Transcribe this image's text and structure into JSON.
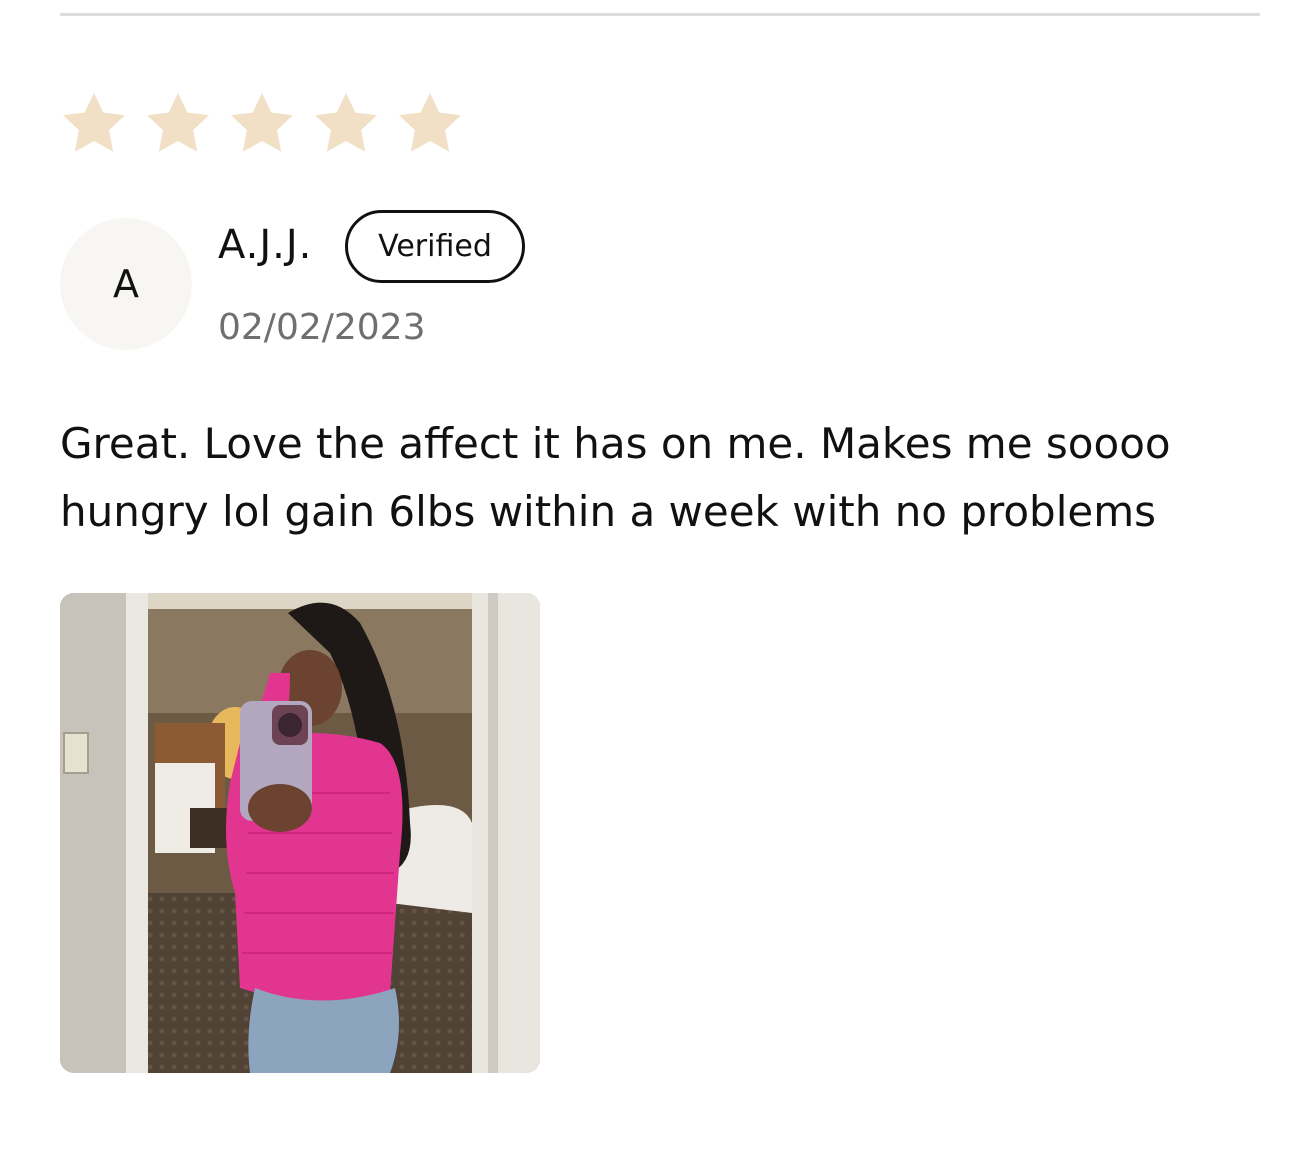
{
  "review": {
    "rating": 5,
    "rating_max": 5,
    "star_color": "#f1dfc6",
    "avatar_initial": "A",
    "reviewer_name": "A.J.J.",
    "verified_label": "Verified",
    "date": "02/02/2023",
    "body": "Great. Love the affect it has on me. Makes me soooo hungry lol gain 6lbs within a week with no problems",
    "photo_icon": "review-photo"
  }
}
